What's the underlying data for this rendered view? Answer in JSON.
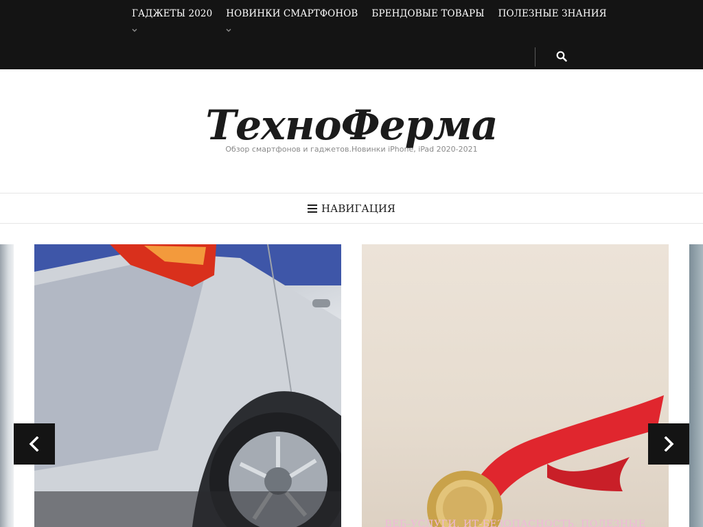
{
  "top_menu": {
    "items": [
      {
        "label": "ГАДЖЕТЫ 2020",
        "has_submenu": true
      },
      {
        "label": "НОВИНКИ СМАРТФОНОВ",
        "has_submenu": true
      },
      {
        "label": "БРЕНДОВЫЕ ТОВАРЫ",
        "has_submenu": false
      },
      {
        "label": "ПОЛЕЗНЫЕ ЗНАНИЯ",
        "has_submenu": false
      }
    ],
    "search_icon": "search-icon"
  },
  "header": {
    "logo_text": "ТехноФерма",
    "tagline": "Обзор смартфонов и гаджетов.Новинки iPhone, iPad 2020-2021"
  },
  "navigation": {
    "label": "НАВИГАЦИЯ",
    "icon": "hamburger-icon"
  },
  "slider": {
    "slides": [
      {
        "name": "car-in-frost",
        "caption": ""
      },
      {
        "name": "gold-medal-red-ribbon",
        "caption": "ВЕБ-УСЛУГИ, ИТ-БЕЗОПАСНОСТЬ, ПОЛЕЗНЫЕ"
      }
    ],
    "prev_icon": "chevron-left-icon",
    "next_icon": "chevron-right-icon"
  },
  "colors": {
    "topbar_bg": "#141414",
    "text_dark": "#1b1b1b",
    "tagline": "#8a8a8a",
    "caption": "#f0b9d9",
    "medal_ribbon": "#e0262e",
    "medal_gold": "#c9a24a"
  }
}
